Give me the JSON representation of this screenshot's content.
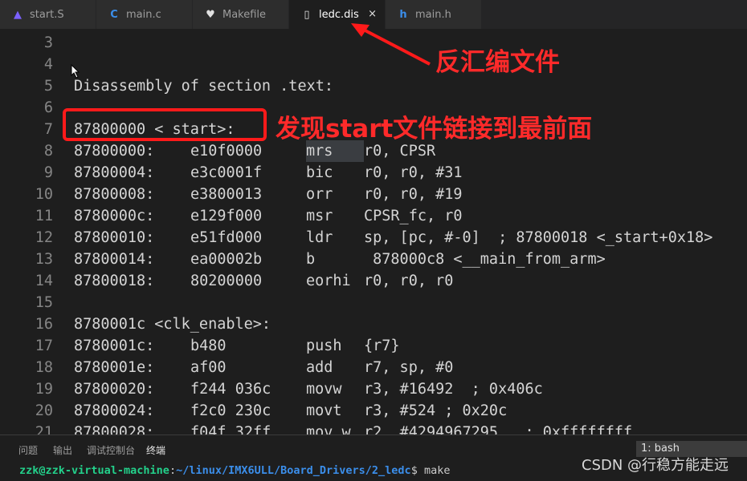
{
  "tabs": [
    {
      "label": "start.S",
      "icon": "asm-icon",
      "color": "#7b61ff"
    },
    {
      "label": "main.c",
      "icon": "c-icon",
      "color": "#3b8eea"
    },
    {
      "label": "Makefile",
      "icon": "makefile-icon",
      "color": "#e0e0e0"
    },
    {
      "label": "ledc.dis",
      "icon": "file-icon",
      "color": "#e0e0e0",
      "active": true
    },
    {
      "label": "main.h",
      "icon": "h-icon",
      "color": "#3b8eea"
    }
  ],
  "close_glyph": "×",
  "lines": [
    {
      "n": "3",
      "text": ""
    },
    {
      "n": "4",
      "text": ""
    },
    {
      "n": "5",
      "text": "Disassembly of section .text:"
    },
    {
      "n": "6",
      "text": ""
    },
    {
      "n": "7",
      "text": "87800000 < start>:"
    },
    {
      "n": "8",
      "addr": "87800000:",
      "hex": "e10f0000",
      "op": "mrs",
      "args": "r0, CPSR"
    },
    {
      "n": "9",
      "addr": "87800004:",
      "hex": "e3c0001f",
      "op": "bic",
      "args": "r0, r0, #31"
    },
    {
      "n": "10",
      "addr": "87800008:",
      "hex": "e3800013",
      "op": "orr",
      "args": "r0, r0, #19"
    },
    {
      "n": "11",
      "addr": "8780000c:",
      "hex": "e129f000",
      "op": "msr",
      "args": "CPSR_fc, r0"
    },
    {
      "n": "12",
      "addr": "87800010:",
      "hex": "e51fd000",
      "op": "ldr",
      "args": "sp, [pc, #-0]  ; 87800018 <_start+0x18>"
    },
    {
      "n": "13",
      "addr": "87800014:",
      "hex": "ea00002b",
      "op": "b",
      "args": " 878000c8 <__main_from_arm>"
    },
    {
      "n": "14",
      "addr": "87800018:",
      "hex": "80200000",
      "op": "eorhi",
      "args": "r0, r0, r0"
    },
    {
      "n": "15",
      "text": ""
    },
    {
      "n": "16",
      "text": "8780001c <clk_enable>:"
    },
    {
      "n": "17",
      "addr": "8780001c:",
      "hex": "b480",
      "op": "push",
      "args": "{r7}"
    },
    {
      "n": "18",
      "addr": "8780001e:",
      "hex": "af00",
      "op": "add",
      "args": "r7, sp, #0"
    },
    {
      "n": "19",
      "addr": "87800020:",
      "hex": "f244 036c",
      "op": "movw",
      "args": "r3, #16492  ; 0x406c"
    },
    {
      "n": "20",
      "addr": "87800024:",
      "hex": "f2c0 230c",
      "op": "movt",
      "args": "r3, #524 ; 0x20c"
    },
    {
      "n": "21",
      "addr": "87800028:",
      "hex": "f04f 32ff",
      "op": "mov.w",
      "args": "r2, #4294967295   ; 0xffffffff"
    }
  ],
  "annotations": {
    "disasm_file": "反汇编文件",
    "start_first": "发现start文件链接到最前面"
  },
  "panel": {
    "tabs": [
      "问题",
      "输出",
      "调试控制台",
      "终端"
    ],
    "active_tab": "终端",
    "terminal_select": "1: bash",
    "prompt_user": "zzk@zzk-virtual-machine",
    "prompt_path": "~/linux/IMX6ULL/Board_Drivers/2_ledc",
    "prompt_cmd": "$ make"
  },
  "watermark": "CSDN @行稳方能走远",
  "colors": {
    "annotation": "#ff2a2a",
    "accent": "#3b8eea"
  }
}
